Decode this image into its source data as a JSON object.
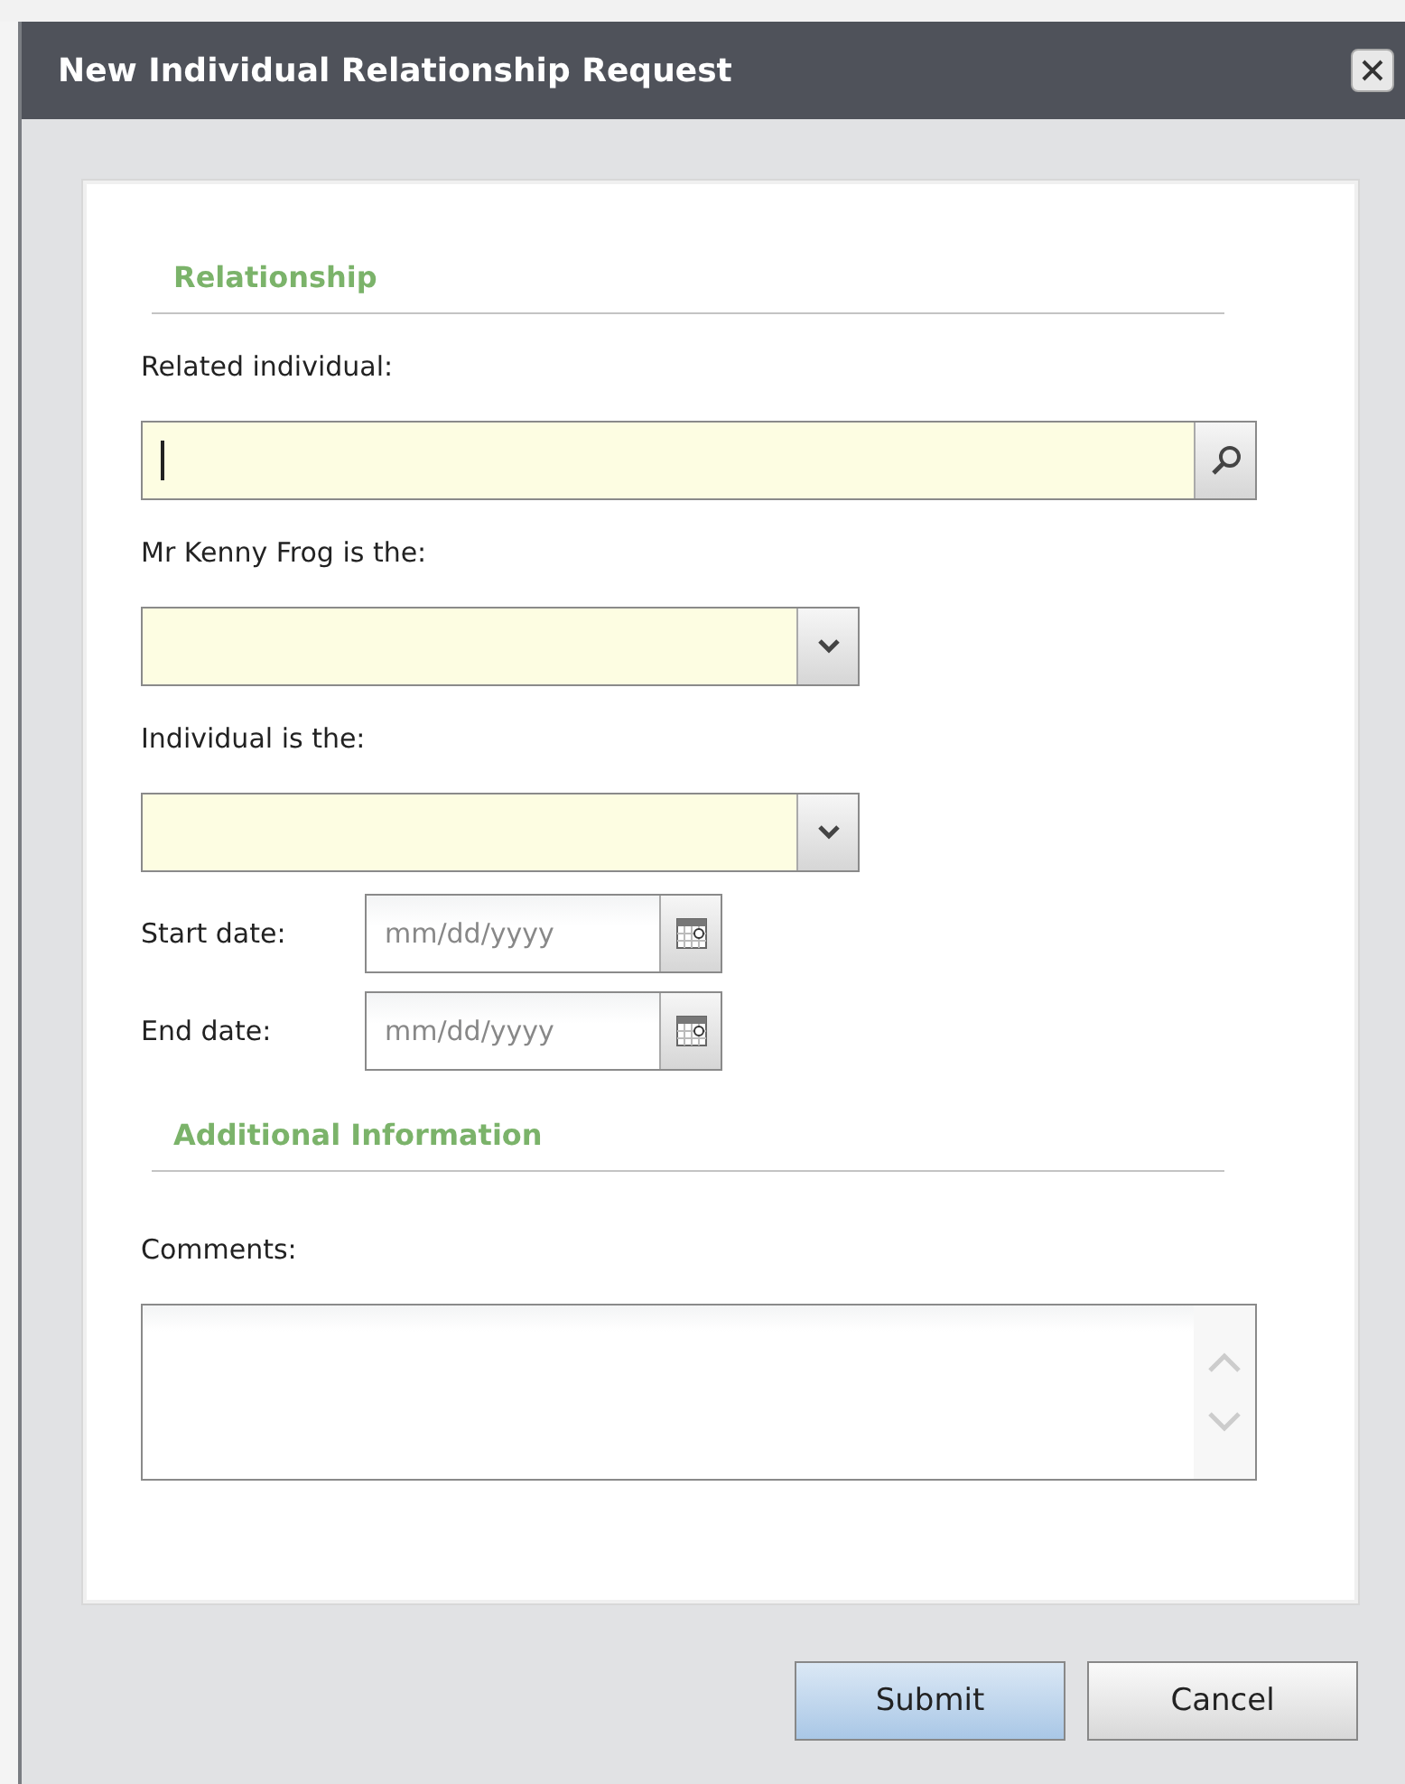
{
  "window": {
    "title": "New Individual Relationship Request"
  },
  "sections": [
    {
      "heading": "Relationship",
      "fields": [
        {
          "kind": "lookup",
          "label": "Related individual:",
          "focused": true
        },
        {
          "kind": "dropdown",
          "label": "Mr Kenny Frog is the:"
        },
        {
          "kind": "dropdown",
          "label": "Individual is the:"
        },
        {
          "kind": "date",
          "label": "Start date:",
          "placeholder": "mm/dd/yyyy"
        },
        {
          "kind": "date",
          "label": "End date:",
          "placeholder": "mm/dd/yyyy"
        }
      ]
    },
    {
      "heading": "Additional Information",
      "fields": [
        {
          "kind": "textarea",
          "label": "Comments:"
        }
      ]
    }
  ],
  "buttons": [
    {
      "label": "Submit",
      "kind": "primary"
    },
    {
      "label": "Cancel",
      "kind": "default"
    }
  ]
}
